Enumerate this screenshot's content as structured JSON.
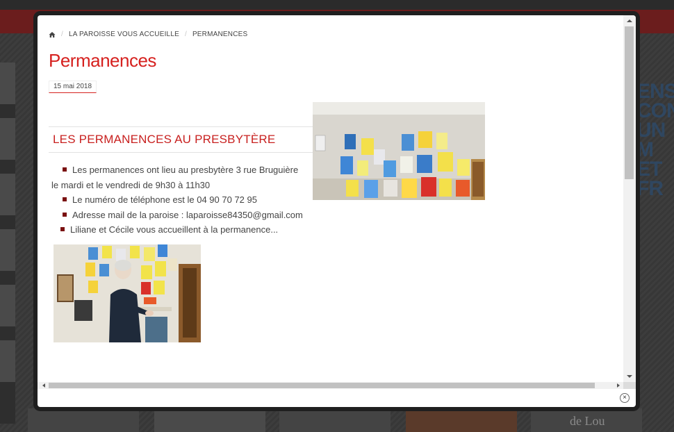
{
  "breadcrumb": {
    "home_icon": "home-icon",
    "separator": "/",
    "items": [
      "LA PAROISSE VOUS ACCUEILLE",
      "PERMANENCES"
    ]
  },
  "article": {
    "title": "Permanences",
    "date": "15 mai 2018",
    "section_title": "LES PERMANENCES AU PRESBYTÈRE",
    "bullets": [
      "Les permanences ont lieu au presbytère 3 rue Bruguière",
      "le mardi et le vendredi de 9h30 à 11h30",
      "Le numéro de téléphone est le 04 90 70 72 95",
      "Adresse mail de la paroise : laparoisse84350@gmail.com",
      "Liliane et Cécile vous accueillent à la permanence..."
    ]
  },
  "background": {
    "right_text": [
      "ENSE",
      "CONS",
      "UN M",
      "ET FR"
    ],
    "bottom_label": "de Lou"
  },
  "modal": {
    "close_icon": "close-icon",
    "close_glyph": "×"
  },
  "colors": {
    "accent": "#d6211f",
    "bullet": "#7a1010",
    "text": "#444444"
  }
}
